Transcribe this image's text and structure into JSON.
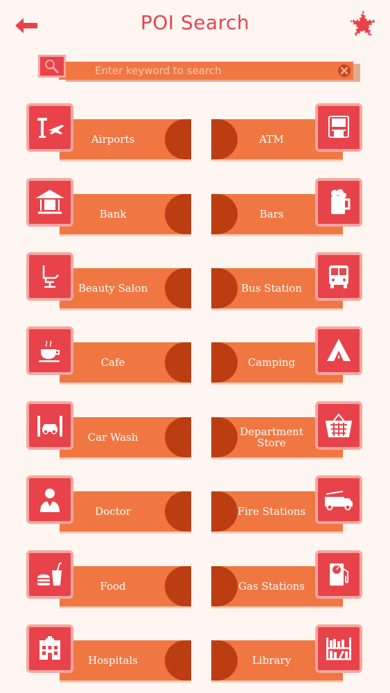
{
  "header": {
    "title": "POI Search",
    "back_icon": "arrow-left-icon",
    "favorite_icon": "star-icon"
  },
  "search": {
    "placeholder": "Enter keyword to search",
    "value": ""
  },
  "colors": {
    "accent_red": "#e8434a",
    "band_orange": "#f07742",
    "dark_orange": "#bd3d12",
    "border_pink": "#f7a6a1",
    "background": "#fff6f2"
  },
  "categories": [
    {
      "label": "Airports",
      "icon": "airport-icon"
    },
    {
      "label": "ATM",
      "icon": "atm-icon"
    },
    {
      "label": "Bank",
      "icon": "bank-icon"
    },
    {
      "label": "Bars",
      "icon": "beer-icon"
    },
    {
      "label": "Beauty Salon",
      "icon": "salon-chair-icon"
    },
    {
      "label": "Bus Station",
      "icon": "bus-icon"
    },
    {
      "label": "Cafe",
      "icon": "coffee-cup-icon"
    },
    {
      "label": "Camping",
      "icon": "tent-icon"
    },
    {
      "label": "Car Wash",
      "icon": "car-wash-icon"
    },
    {
      "label": "Department Store",
      "icon": "basket-icon"
    },
    {
      "label": "Doctor",
      "icon": "doctor-icon"
    },
    {
      "label": "Fire Stations",
      "icon": "fire-truck-icon"
    },
    {
      "label": "Food",
      "icon": "fast-food-icon"
    },
    {
      "label": "Gas Stations",
      "icon": "fuel-pump-icon"
    },
    {
      "label": "Hospitals",
      "icon": "hospital-icon"
    },
    {
      "label": "Library",
      "icon": "bookshelf-icon"
    }
  ]
}
